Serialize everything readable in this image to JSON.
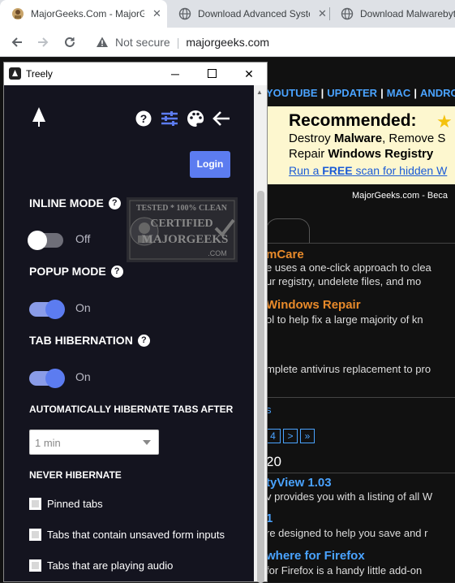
{
  "browser": {
    "tabs": [
      {
        "title": "MajorGeeks.Com - MajorGeeks",
        "active": true
      },
      {
        "title": "Download Advanced SystemCare",
        "active": false
      },
      {
        "title": "Download Malwarebytes",
        "active": false
      }
    ],
    "address": {
      "security": "Not secure",
      "url": "majorgeeks.com"
    }
  },
  "background_page": {
    "nav_links": [
      "YOUTUBE",
      "UPDATER",
      "MAC",
      "ANDROID"
    ],
    "promo": {
      "recommended": "Recommended:",
      "line2_pre": "Destroy ",
      "line2_bold": "Malware",
      "line2_post": ", Remove S",
      "line3_pre": "Repair ",
      "line3_bold": "Windows Registry",
      "link_pre": "Run a ",
      "link_bold": "FREE",
      "link_post": " scan for hidden W"
    },
    "tagline": "MajorGeeks.com - Beca",
    "items": [
      {
        "title": "mCare",
        "text": "e uses a one-click approach to clea"
      },
      {
        "text2": "ur registry, undelete files, and mo"
      },
      {
        "title": "Windows Repair",
        "text": "ol to help fix a large majority of kn"
      },
      {
        "text": "mplete antivirus replacement to pro"
      },
      {
        "link": "s"
      }
    ],
    "pager": [
      "4",
      ">",
      "»"
    ],
    "count": "20",
    "items2": [
      {
        "title": "tyView 1.03",
        "text": "v provides you with a listing of all W"
      },
      {
        "title": "1",
        "text": "re designed to help you save and r"
      },
      {
        "title": "where for Firefox",
        "text": "for Firefox is a handy little add-on"
      }
    ]
  },
  "popup": {
    "window_title": "Treely",
    "login_label": "Login",
    "inline_mode": {
      "label": "INLINE MODE",
      "state": "Off",
      "on": false
    },
    "popup_mode": {
      "label": "POPUP MODE",
      "state": "On",
      "on": true
    },
    "tab_hibernation": {
      "label": "TAB HIBERNATION",
      "state": "On",
      "on": true
    },
    "auto_hibernate_label": "AUTOMATICALLY HIBERNATE TABS AFTER",
    "auto_hibernate_value": "1 min",
    "never_hibernate_label": "NEVER HIBERNATE",
    "never_hibernate_options": [
      "Pinned tabs",
      "Tabs that contain unsaved form inputs",
      "Tabs that are playing audio"
    ],
    "badge": {
      "line1": "TESTED * 100% CLEAN",
      "line2": "CERTIFIED",
      "line3": "MAJORGEEKS",
      "line4": ".COM"
    }
  },
  "colors": {
    "panel_bg": "#14141f",
    "accent": "#5c7cf0",
    "link_blue": "#4aa3ff",
    "title_orange": "#e88a2a"
  }
}
